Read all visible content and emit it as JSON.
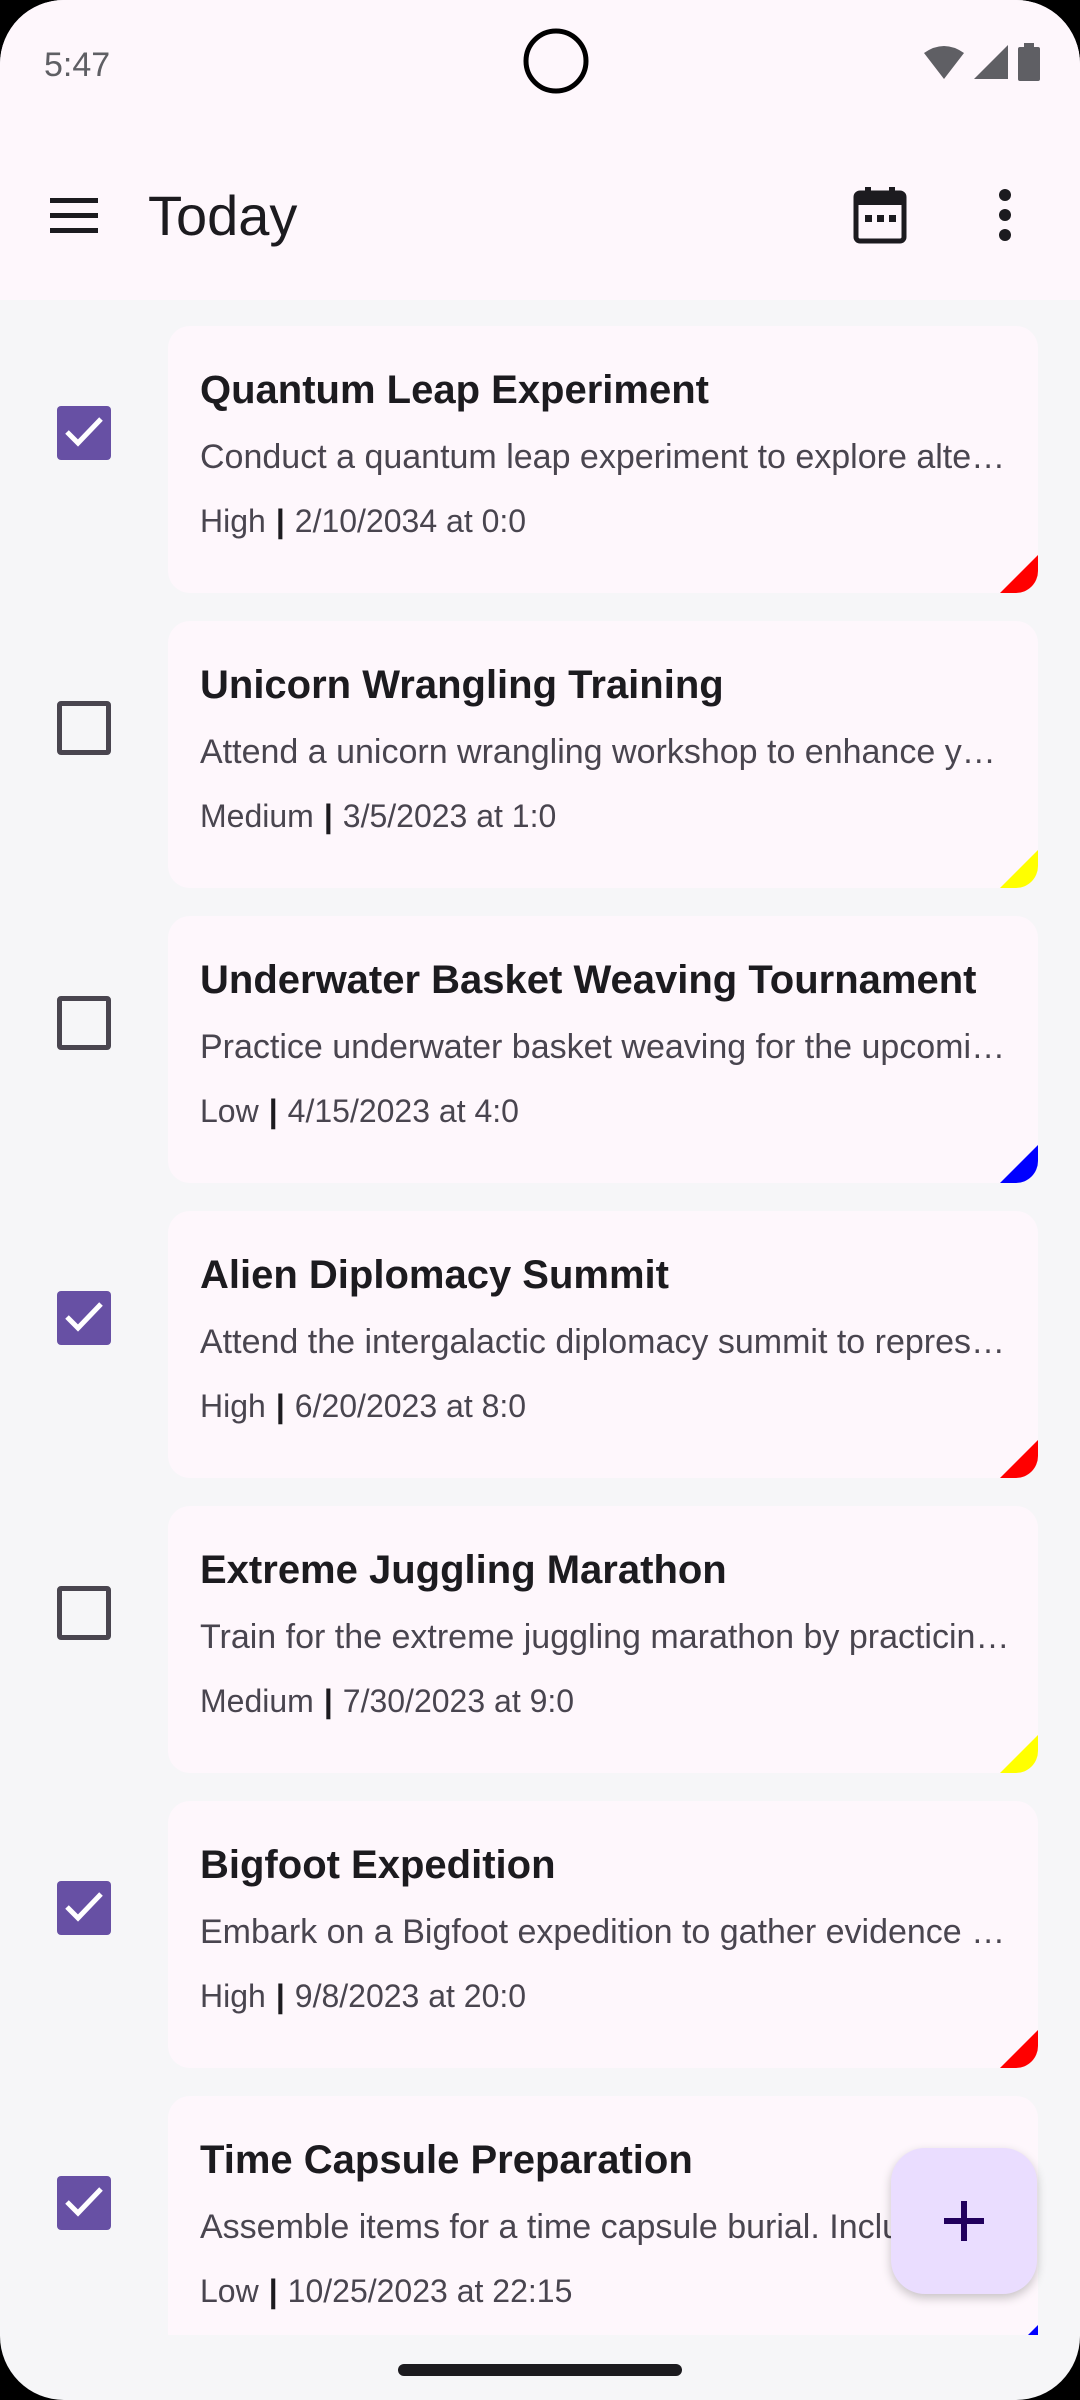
{
  "status_bar": {
    "time": "5:47"
  },
  "app_bar": {
    "title": "Today"
  },
  "tasks": [
    {
      "title": "Quantum Leap Experiment",
      "description": "Conduct a quantum leap experiment to explore alternate timelines",
      "priority": "High",
      "datetime": "2/10/2034 at 0:0",
      "checked": true,
      "priority_color": "#FF0000"
    },
    {
      "title": "Unicorn Wrangling Training",
      "description": "Attend a unicorn wrangling workshop to enhance your skills",
      "priority": "Medium",
      "datetime": "3/5/2023 at 1:0",
      "checked": false,
      "priority_color": "#FFFF00"
    },
    {
      "title": "Underwater Basket Weaving Tournament",
      "description": "Practice underwater basket weaving for the upcoming tournament",
      "priority": "Low",
      "datetime": "4/15/2023 at 4:0",
      "checked": false,
      "priority_color": "#0000FF"
    },
    {
      "title": "Alien Diplomacy Summit",
      "description": "Attend the intergalactic diplomacy summit to represent Earth",
      "priority": "High",
      "datetime": "6/20/2023 at 8:0",
      "checked": true,
      "priority_color": "#FF0000"
    },
    {
      "title": "Extreme Juggling Marathon",
      "description": "Train for the extreme juggling marathon by practicing daily",
      "priority": "Medium",
      "datetime": "7/30/2023 at 9:0",
      "checked": false,
      "priority_color": "#FFFF00"
    },
    {
      "title": "Bigfoot Expedition",
      "description": "Embark on a Bigfoot expedition to gather evidence of its existence",
      "priority": "High",
      "datetime": "9/8/2023 at 20:0",
      "checked": true,
      "priority_color": "#FF0000"
    },
    {
      "title": "Time Capsule Preparation",
      "description": "Assemble items for a time capsule burial. Include letters",
      "priority": "Low",
      "datetime": "10/25/2023 at 22:15",
      "checked": true,
      "priority_color": "#0000FF"
    }
  ],
  "colors": {
    "accent": "#6750A4",
    "fab_bg": "#EADDFF",
    "surface": "#FEF7FC"
  },
  "icons": {
    "menu": "menu-icon",
    "calendar": "calendar-icon",
    "more": "more-vert-icon",
    "add": "add-icon"
  }
}
